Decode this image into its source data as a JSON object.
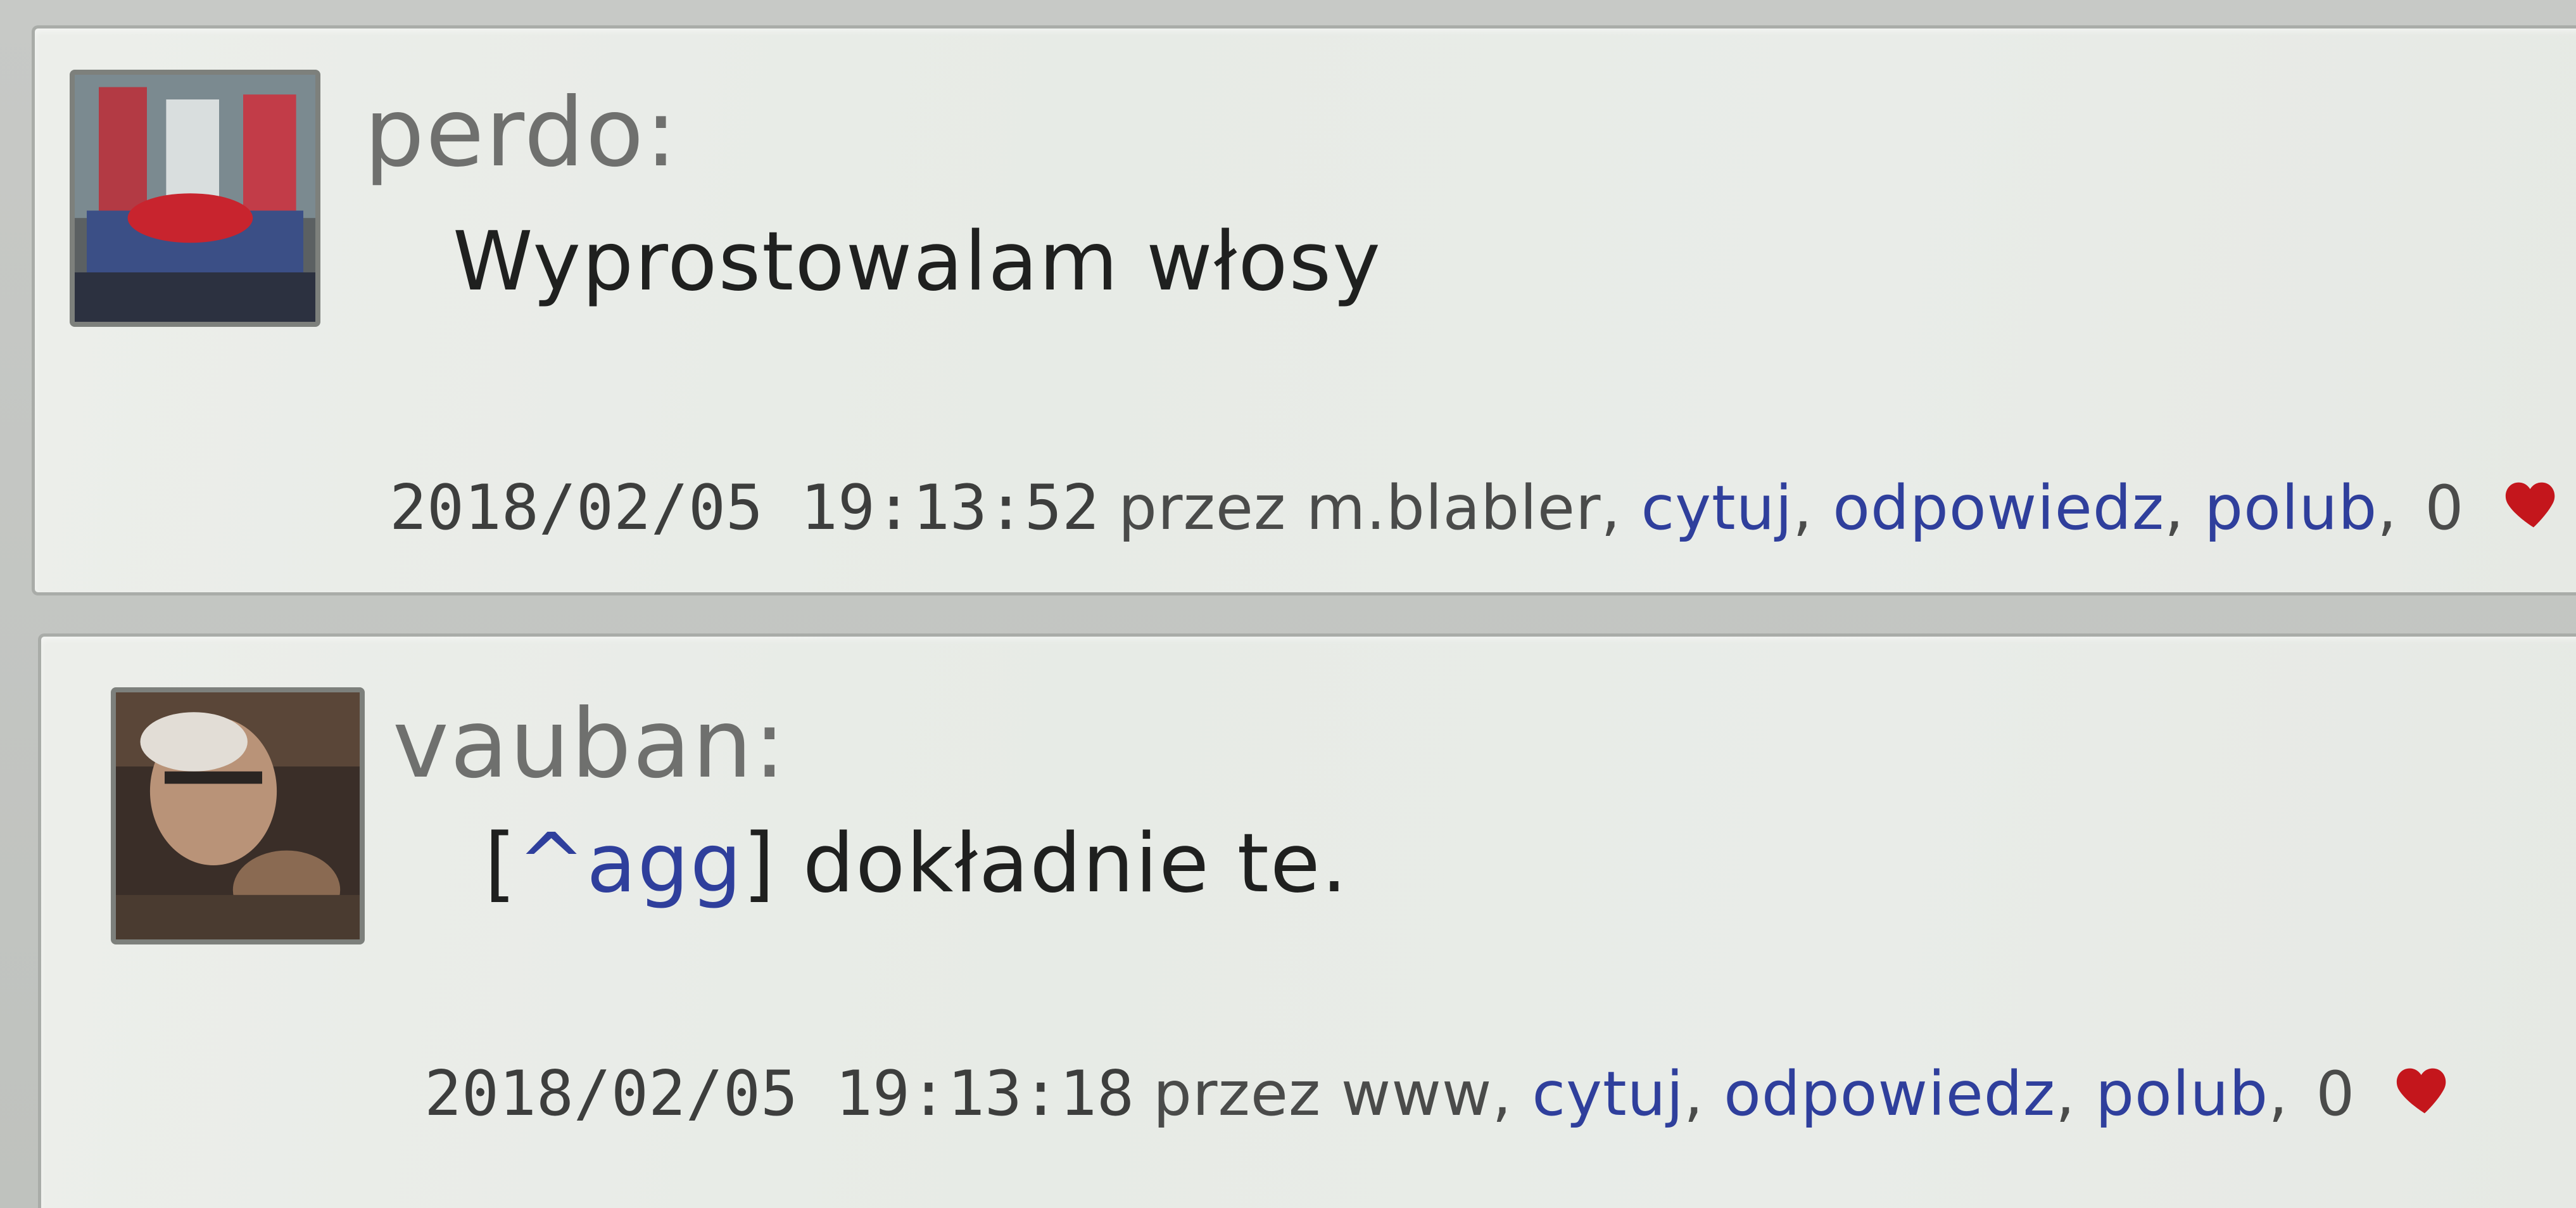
{
  "posts": [
    {
      "username": "perdo:",
      "content_text": "Wyprostowalam włosy",
      "timestamp": "2018/02/05 19:13:52",
      "author_text": "przez m.blabler,",
      "actions": {
        "quote": "cytuj",
        "reply": "odpowiedz",
        "like": "polub"
      },
      "separator": ",",
      "like_count": "0",
      "avatar_icon": "avatar-photo-icon",
      "heart_icon": "heart-icon"
    },
    {
      "username": "vauban:",
      "content_open_bracket": "[",
      "content_quote_ref": "^agg",
      "content_close_bracket": "]",
      "content_text": " dokładnie te.",
      "timestamp": "2018/02/05 19:13:18",
      "author_text": "przez www,",
      "actions": {
        "quote": "cytuj",
        "reply": "odpowiedz",
        "like": "polub"
      },
      "separator": ",",
      "like_count": "0",
      "avatar_icon": "avatar-photo-icon",
      "heart_icon": "heart-icon"
    }
  ],
  "colors": {
    "link": "#2f3f9c",
    "username": "#6f706e",
    "heart": "#c4161c"
  }
}
